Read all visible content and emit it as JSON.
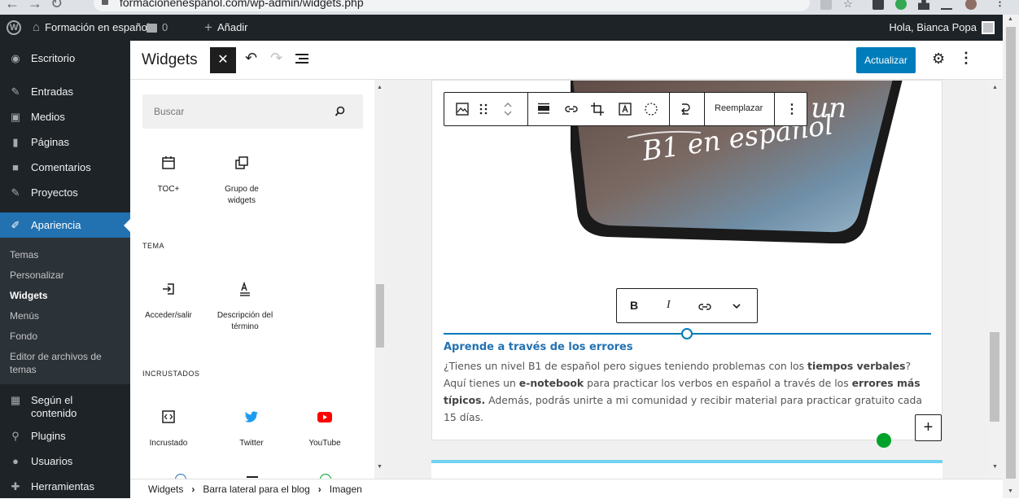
{
  "browser": {
    "url": "formacionenespanol.com/wp-admin/widgets.php"
  },
  "adminbar": {
    "site_name": "Formación en español",
    "comments_count": "0",
    "new_label": "Añadir",
    "greeting": "Hola, Bianca Popa"
  },
  "sidebar": {
    "items": [
      {
        "label": "Escritorio",
        "icon": "dashboard-icon"
      },
      {
        "label": "Entradas",
        "icon": "pin-icon"
      },
      {
        "label": "Medios",
        "icon": "media-icon"
      },
      {
        "label": "Páginas",
        "icon": "page-icon"
      },
      {
        "label": "Comentarios",
        "icon": "comment-icon"
      },
      {
        "label": "Proyectos",
        "icon": "pin-icon"
      },
      {
        "label": "Apariencia",
        "icon": "brush-icon"
      },
      {
        "label": "Según el contenido",
        "icon": "table-icon"
      },
      {
        "label": "Plugins",
        "icon": "plugin-icon"
      },
      {
        "label": "Usuarios",
        "icon": "user-icon"
      },
      {
        "label": "Herramientas",
        "icon": "wrench-icon"
      }
    ],
    "submenu": [
      "Temas",
      "Personalizar",
      "Widgets",
      "Menús",
      "Fondo",
      "Editor de archivos de temas"
    ]
  },
  "editor": {
    "title": "Widgets",
    "update_label": "Actualizar"
  },
  "inserter": {
    "search_placeholder": "Buscar",
    "blocks_top": [
      {
        "label": "TOC+",
        "icon": "calendar-icon"
      },
      {
        "label": "Grupo de widgets",
        "icon": "group-icon"
      }
    ],
    "category_theme": "TEMA",
    "blocks_theme": [
      {
        "label": "Acceder/salir",
        "icon": "login-icon"
      },
      {
        "label": "Descripción del término",
        "icon": "term-description-icon"
      }
    ],
    "category_embed": "INCRUSTADOS",
    "blocks_embed": [
      {
        "label": "Incrustado",
        "icon": "embed-icon"
      },
      {
        "label": "Twitter",
        "icon": "twitter-icon"
      },
      {
        "label": "YouTube",
        "icon": "youtube-icon"
      }
    ]
  },
  "canvas": {
    "image_overlay_text": [
      "nes un",
      "B1 en español"
    ],
    "toolbar_replace": "Reemplazar",
    "caption_toolbar": {
      "bold": "B",
      "italic": "I"
    },
    "caption_title": "Aprende a través de los errores",
    "caption_segments": [
      {
        "text": "¿Tienes un nivel B1 de español pero sigues teniendo problemas con los ",
        "bold": false
      },
      {
        "text": "tiempos verbales",
        "bold": true
      },
      {
        "text": "? Aquí tienes un ",
        "bold": false
      },
      {
        "text": "e-notebook",
        "bold": true
      },
      {
        "text": " para practicar los verbos en español a través de los ",
        "bold": false
      },
      {
        "text": "errores más típicos.",
        "bold": true
      },
      {
        "text": " Además, podrás unirte a mi comunidad y recibir material para practicar gratuito cada 15 días.",
        "bold": false
      }
    ]
  },
  "breadcrumb": [
    "Widgets",
    "Barra lateral para el blog",
    "Imagen"
  ],
  "colors": {
    "admin_dark": "#1d2327",
    "accent": "#2271b1",
    "button_blue": "#007cba",
    "youtube_red": "#ff0000",
    "twitter_blue": "#1d9bf0"
  }
}
